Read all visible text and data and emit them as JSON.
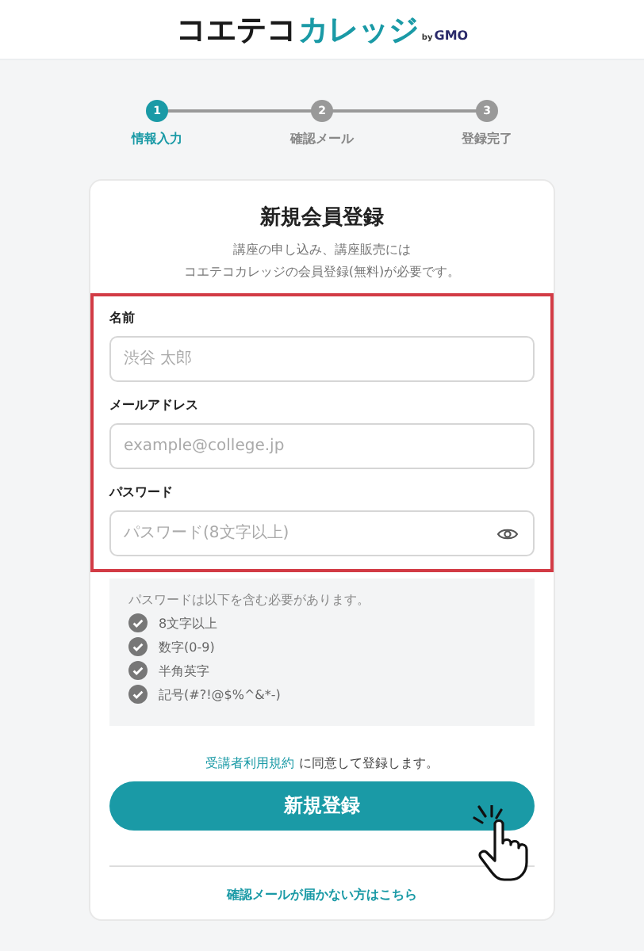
{
  "logo": {
    "primary": "コエテコ",
    "accent": "カレッジ",
    "by": "by",
    "brand": "GMO"
  },
  "steps": [
    {
      "number": "1",
      "label": "情報入力",
      "selected": true
    },
    {
      "number": "2",
      "label": "確認メール",
      "selected": false
    },
    {
      "number": "3",
      "label": "登録完了",
      "selected": false
    }
  ],
  "form": {
    "title": "新規会員登録",
    "intro": [
      "講座の申し込み、講座販売には",
      "コエテコカレッジの会員登録(無料)が必要です。"
    ],
    "fields": [
      {
        "label": "名前",
        "placeholder": "渋谷 太郎",
        "kind": "text"
      },
      {
        "label": "メールアドレス",
        "placeholder": "example@college.jp",
        "kind": "text"
      },
      {
        "label": "パスワード",
        "placeholder": "パスワード(8文字以上)",
        "kind": "password"
      }
    ],
    "rules_title": "パスワードは以下を含む必要があります。",
    "rules": [
      "8文字以上",
      "数字(0-9)",
      "半角英字",
      "記号(#?!@$%^&*-)"
    ],
    "terms_link": "受講者利用規約",
    "terms_rest": " に同意して登録します。",
    "submit": "新規登録",
    "resend_link": "確認メールが届かない方はこちら"
  }
}
